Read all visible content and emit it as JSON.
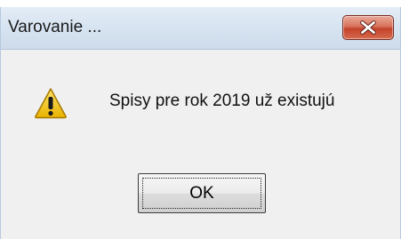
{
  "dialog": {
    "title": "Varovanie ...",
    "message": "Spisy pre rok 2019 už existujú",
    "ok_label": "OK",
    "icons": {
      "close": "close-icon",
      "warning": "warning-icon"
    },
    "colors": {
      "close_button": "#c4432b",
      "warning_fill": "#f2c318",
      "background": "#f0f0f0"
    }
  }
}
